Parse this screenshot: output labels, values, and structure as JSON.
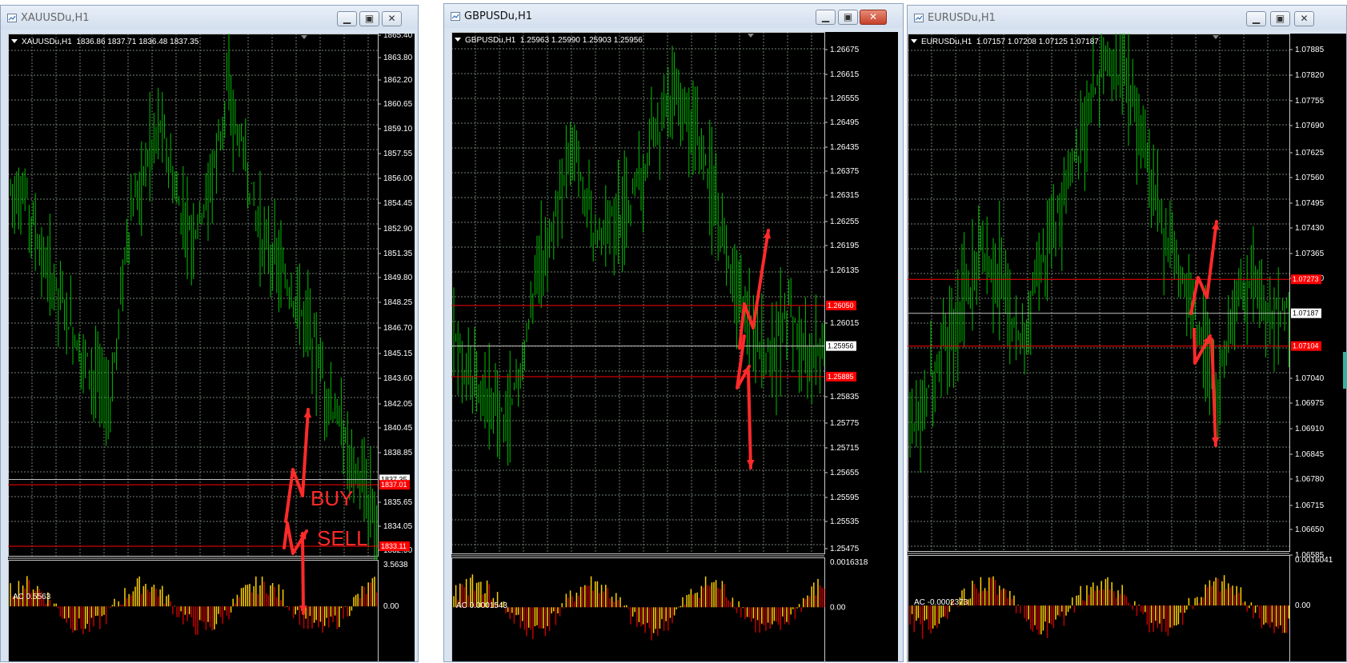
{
  "colors": {
    "candle": "#00c000",
    "grid": "#6f7f6f",
    "level_line": "#ff0000",
    "price_tag_bg": "#ff0000",
    "current_price_line": "#c0c0c0",
    "arrow": "#ff2a2a",
    "ac_up": "#ffd000",
    "ac_down": "#c00000"
  },
  "windows": [
    {
      "id": "xau",
      "title": "XAUUSDu,H1",
      "active": false,
      "icon": "chart-window-icon",
      "buttons": [
        "minimize-icon",
        "maximize-icon",
        "close-icon"
      ],
      "info": "XAUUSDu,H1  1836.86 1837.71 1836.48 1837.35",
      "price_scale": [
        "1865.40",
        "1863.80",
        "1862.20",
        "1860.65",
        "1859.10",
        "1857.55",
        "1856.00",
        "1854.45",
        "1852.90",
        "1851.35",
        "1849.80",
        "1848.25",
        "1846.70",
        "1845.15",
        "1843.60",
        "1842.05",
        "1840.45",
        "1838.85",
        "1835.65",
        "1834.05",
        "1832.50"
      ],
      "levels": [
        {
          "price": 1837.35,
          "label": "1837.35",
          "type": "current"
        },
        {
          "price": 1837.01,
          "label": "1837.01",
          "type": "level"
        },
        {
          "price": 1833.11,
          "label": "1833.11",
          "type": "level"
        }
      ],
      "annotations": [
        "BUY",
        "SELL"
      ],
      "indicator": {
        "label": "AC 0.5563",
        "max": "3.5638",
        "zero": "0.00"
      }
    },
    {
      "id": "gbp",
      "title": "GBPUSDu,H1",
      "active": true,
      "icon": "chart-window-icon",
      "buttons": [
        "minimize-icon",
        "maximize-icon",
        "close-icon"
      ],
      "info": "GBPUSDu,H1  1.25963 1.25990 1.25903 1.25956",
      "price_scale": [
        "1.26675",
        "1.26615",
        "1.26555",
        "1.26495",
        "1.26435",
        "1.26375",
        "1.26315",
        "1.26255",
        "1.26195",
        "1.26135",
        "1.26015",
        "1.25835",
        "1.25775",
        "1.25715",
        "1.25655",
        "1.25595",
        "1.25535",
        "1.25475"
      ],
      "levels": [
        {
          "price": 1.2605,
          "label": "1.26050",
          "type": "level"
        },
        {
          "price": 1.25956,
          "label": "1.25956",
          "type": "current"
        },
        {
          "price": 1.25885,
          "label": "1.25885",
          "type": "level"
        }
      ],
      "annotations": [],
      "indicator": {
        "label": "AC 0.0001543",
        "max": "0.0016318",
        "zero": "0.00"
      }
    },
    {
      "id": "eur",
      "title": "EURUSDu,H1",
      "active": false,
      "icon": "chart-window-icon",
      "buttons": [
        "minimize-icon",
        "maximize-icon",
        "close-icon"
      ],
      "info": "EURUSDu,H1  1.07157 1.07208 1.07125 1.07187",
      "price_scale": [
        "1.07885",
        "1.07820",
        "1.07755",
        "1.07690",
        "1.07625",
        "1.07560",
        "1.07495",
        "1.07430",
        "1.07365",
        "1.07300",
        "1.07040",
        "1.06975",
        "1.06910",
        "1.06845",
        "1.06780",
        "1.06715",
        "1.06650",
        "1.06585"
      ],
      "levels": [
        {
          "price": 1.07273,
          "label": "1.07273",
          "type": "level"
        },
        {
          "price": 1.07187,
          "label": "1.07187",
          "type": "current"
        },
        {
          "price": 1.07104,
          "label": "1.07104",
          "type": "level"
        }
      ],
      "annotations": [],
      "indicator": {
        "label": "AC -0.0002373",
        "max": "0.0016041",
        "zero": "0.00"
      }
    }
  ]
}
